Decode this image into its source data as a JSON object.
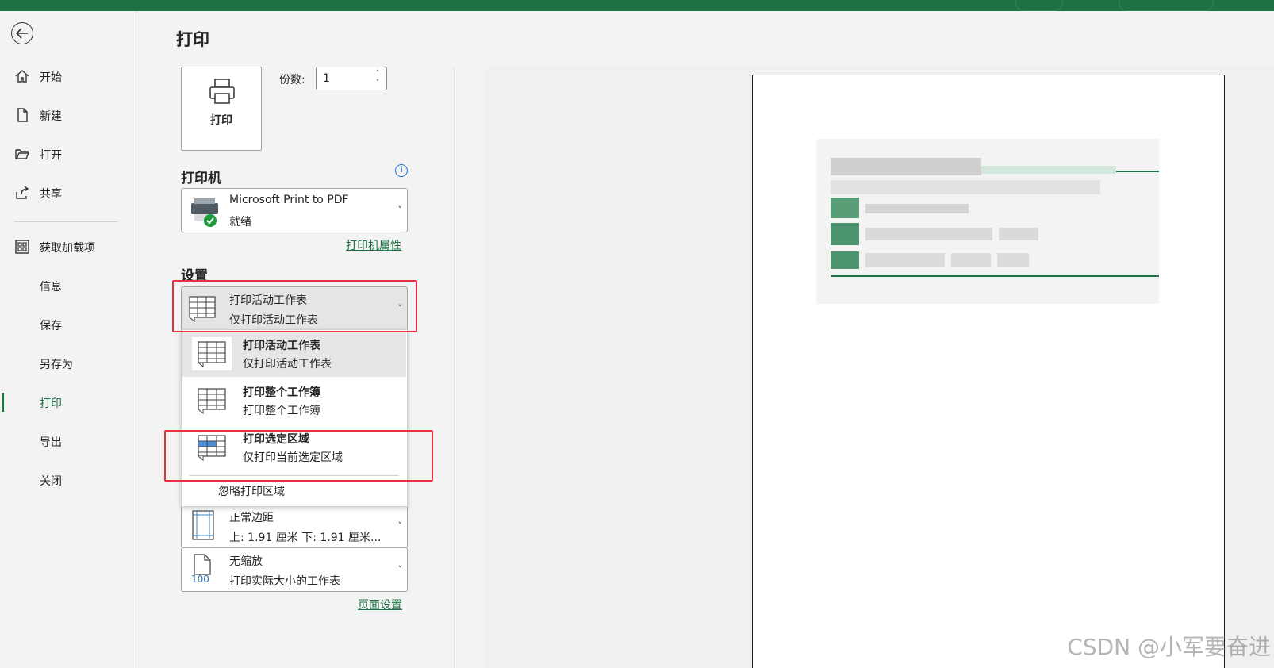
{
  "sidebar": {
    "back_label": "",
    "items": [
      {
        "label": "开始",
        "icon": "home-icon"
      },
      {
        "label": "新建",
        "icon": "new-document-icon"
      },
      {
        "label": "打开",
        "icon": "folder-open-icon"
      },
      {
        "label": "共享",
        "icon": "share-icon"
      },
      {
        "label": "获取加载项",
        "icon": "add-ins-grid-icon"
      },
      {
        "label": "信息"
      },
      {
        "label": "保存"
      },
      {
        "label": "另存为"
      },
      {
        "label": "打印",
        "active": true
      },
      {
        "label": "导出"
      },
      {
        "label": "关闭"
      }
    ]
  },
  "main": {
    "title": "打印",
    "print_button_label": "打印",
    "copies": {
      "label": "份数:",
      "value": "1"
    },
    "printer_section": {
      "title": "打印机",
      "name": "Microsoft Print to PDF",
      "status": "就绪",
      "properties_link": "打印机属性"
    },
    "settings_section": {
      "title": "设置",
      "scope_dropdown": {
        "line1": "打印活动工作表",
        "line2": "仅打印活动工作表"
      },
      "scope_menu": [
        {
          "title": "打印活动工作表",
          "desc": "仅打印活动工作表"
        },
        {
          "title": "打印整个工作簿",
          "desc": "打印整个工作簿"
        },
        {
          "title": "打印选定区域",
          "desc": "仅打印当前选定区域"
        }
      ],
      "ignore_print_area": "忽略打印区域",
      "margins_dropdown": {
        "line1": "正常边距",
        "line2": "上: 1.91 厘米 下: 1.91 厘米..."
      },
      "scaling_dropdown": {
        "line1": "无缩放",
        "line2": "打印实际大小的工作表",
        "icon_text": "100"
      },
      "page_setup_link": "页面设置"
    }
  },
  "watermark": "CSDN @小军要奋进",
  "colors": {
    "accent": "#1e7145",
    "highlight": "#e8303f",
    "link": "#1e7145"
  }
}
